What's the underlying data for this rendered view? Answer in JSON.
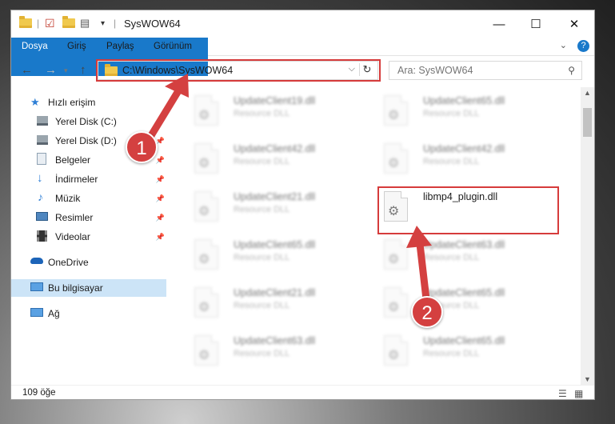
{
  "window": {
    "title": "SysWOW64"
  },
  "ribbon": {
    "tabs": [
      "Dosya",
      "Giriş",
      "Paylaş",
      "Görünüm"
    ]
  },
  "address": {
    "path": "C:\\Windows\\SysWOW64"
  },
  "search": {
    "placeholder": "Ara: SysWOW64"
  },
  "sidebar": {
    "items": [
      {
        "label": "Hızlı erişim",
        "icon": "star-icon"
      },
      {
        "label": "Yerel Disk (C:)",
        "icon": "drive-icon"
      },
      {
        "label": "Yerel Disk (D:)",
        "icon": "drive-icon"
      },
      {
        "label": "Belgeler",
        "icon": "documents-icon"
      },
      {
        "label": "İndirmeler",
        "icon": "download-icon"
      },
      {
        "label": "Müzik",
        "icon": "music-icon"
      },
      {
        "label": "Resimler",
        "icon": "pictures-icon"
      },
      {
        "label": "Videolar",
        "icon": "videos-icon"
      },
      {
        "label": "OneDrive",
        "icon": "cloud-icon"
      },
      {
        "label": "Bu bilgisayar",
        "icon": "computer-icon"
      },
      {
        "label": "Ağ",
        "icon": "network-icon"
      }
    ]
  },
  "files": {
    "left": [
      {
        "name": "UpdateClient19.dll",
        "type": "Resource DLL"
      },
      {
        "name": "UpdateClient42.dll",
        "type": "Resource DLL"
      },
      {
        "name": "UpdateClient21.dll",
        "type": "Resource DLL"
      },
      {
        "name": "UpdateClient65.dll",
        "type": "Resource DLL"
      },
      {
        "name": "UpdateClient21.dll",
        "type": "Resource DLL"
      },
      {
        "name": "UpdateClient63.dll",
        "type": "Resource DLL"
      }
    ],
    "right": [
      {
        "name": "UpdateClient65.dll",
        "type": "Resource DLL"
      },
      {
        "name": "UpdateClient42.dll",
        "type": "Resource DLL"
      },
      {
        "name": "libmp4_plugin.dll",
        "type": ""
      },
      {
        "name": "UpdateClient63.dll",
        "type": "Resource DLL"
      },
      {
        "name": "UpdateClient65.dll",
        "type": "Resource DLL"
      },
      {
        "name": "UpdateClient65.dll",
        "type": "Resource DLL"
      }
    ]
  },
  "status": {
    "count": "109 öğe"
  },
  "callouts": {
    "one": "1",
    "two": "2"
  },
  "colors": {
    "accent": "#1979ca",
    "highlight": "#d63b3b",
    "selected": "#cce4f7"
  }
}
